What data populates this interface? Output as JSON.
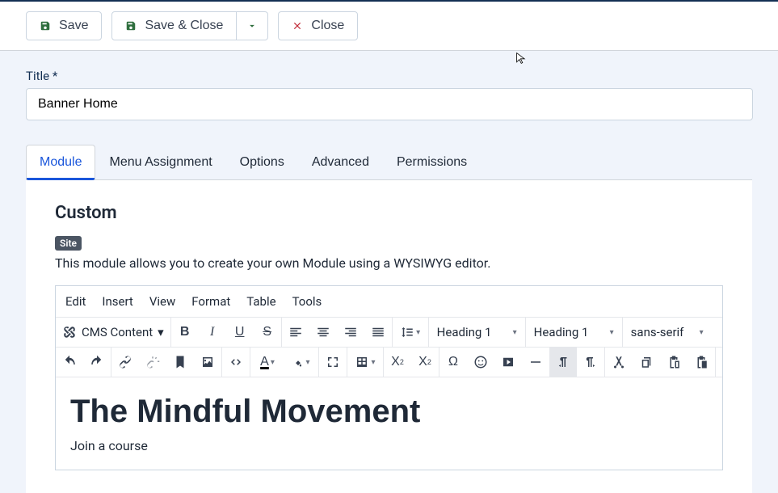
{
  "toolbar": {
    "save": "Save",
    "save_close": "Save & Close",
    "close": "Close"
  },
  "form": {
    "title_label": "Title *",
    "title_value": "Banner Home"
  },
  "tabs": [
    "Module",
    "Menu Assignment",
    "Options",
    "Advanced",
    "Permissions"
  ],
  "active_tab": 0,
  "section": {
    "heading": "Custom",
    "badge": "Site",
    "description": "This module allows you to create your own Module using a WYSIWYG editor."
  },
  "editor": {
    "menubar": [
      "Edit",
      "Insert",
      "View",
      "Format",
      "Table",
      "Tools"
    ],
    "cms_label": "CMS Content",
    "block_format": "Heading 1",
    "style_format": "Heading 1",
    "font_family": "sans-serif",
    "content_heading": "The Mindful Movement",
    "content_paragraph": "Join a course"
  }
}
